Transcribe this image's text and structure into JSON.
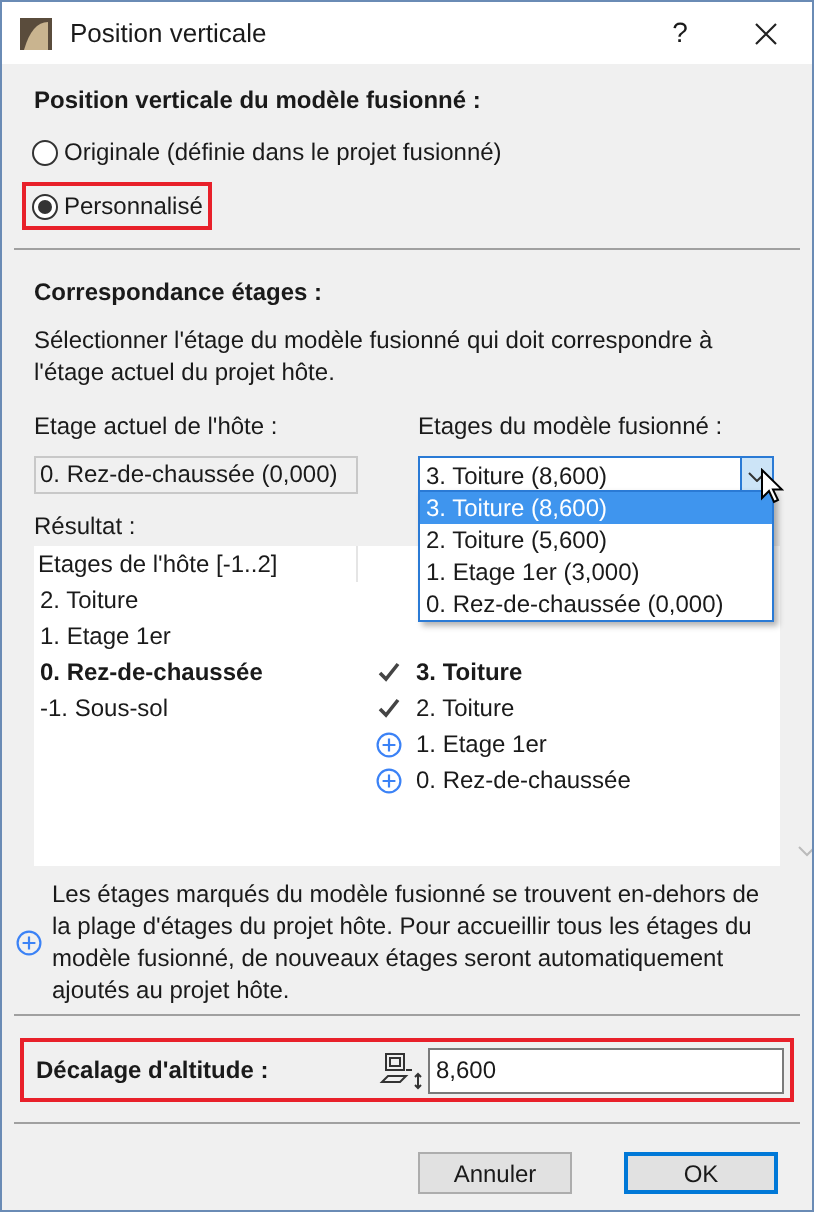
{
  "window": {
    "title": "Position verticale",
    "help": "?"
  },
  "position": {
    "heading": "Position verticale du modèle fusionné :",
    "options": [
      {
        "label": "Originale (définie dans le projet fusionné)",
        "selected": false,
        "highlighted": false
      },
      {
        "label": "Personnalisé",
        "selected": true,
        "highlighted": true
      }
    ]
  },
  "correspondence": {
    "heading": "Correspondance étages :",
    "description": "Sélectionner l'étage du modèle fusionné qui doit correspondre à l'étage actuel du projet hôte.",
    "host_label": "Etage actuel de l'hôte :",
    "host_value": "0. Rez-de-chaussée (0,000)",
    "merged_label": "Etages du modèle fusionné :",
    "merged_value": "3. Toiture (8,600)",
    "expanded": true,
    "merged_options": [
      {
        "label": "3. Toiture (8,600)",
        "selected": true
      },
      {
        "label": "2. Toiture (5,600)",
        "selected": false
      },
      {
        "label": "1. Etage 1er (3,000)",
        "selected": false
      },
      {
        "label": "0. Rez-de-chaussée (0,000)",
        "selected": false
      }
    ]
  },
  "result": {
    "label": "Résultat :",
    "host_header": "Etages de l'hôte [-1..2]",
    "rows": [
      {
        "host": "2. Toiture",
        "kind": "plain",
        "current": false
      },
      {
        "host": "1. Etage 1er",
        "kind": "plain",
        "current": false
      },
      {
        "host": "0. Rez-de-chaussée",
        "merged": "3. Toiture",
        "kind": "matched",
        "current": true
      },
      {
        "host": "-1. Sous-sol",
        "merged": "2. Toiture",
        "kind": "matched",
        "current": false
      },
      {
        "merged": "1. Etage 1er",
        "kind": "added",
        "current": false
      },
      {
        "merged": "0. Rez-de-chaussée",
        "kind": "added",
        "current": false
      }
    ]
  },
  "note": "Les étages marqués du modèle fusionné se trouvent en-dehors de la plage d'étages du projet hôte. Pour accueillir tous les étages du modèle fusionné, de nouveaux étages seront automatiquement ajoutés au projet hôte.",
  "offset": {
    "label": "Décalage d'altitude :",
    "value": "8,600",
    "highlighted": true
  },
  "buttons": [
    "Annuler",
    "OK"
  ]
}
